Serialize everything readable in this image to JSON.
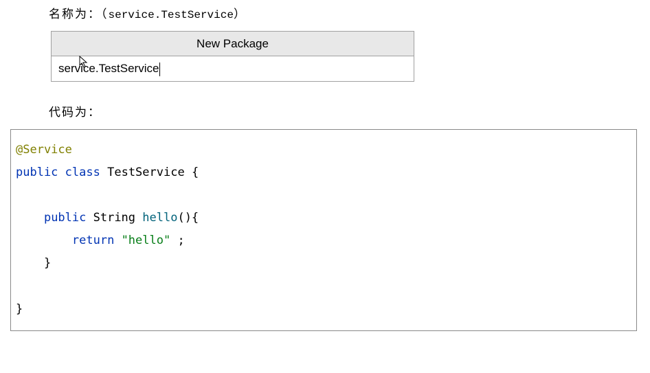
{
  "headings": {
    "name_prefix": "名称为：（",
    "name_value": "service.TestService",
    "name_suffix": "）",
    "code_label": "代码为："
  },
  "dialog": {
    "title": "New Package",
    "input_value": "service.TestService"
  },
  "code": {
    "annotation": "@Service",
    "kw_public1": "public",
    "kw_class": "class",
    "classname": "TestService",
    "brace_open": " {",
    "blank": "",
    "indent1": "    ",
    "kw_public2": "public",
    "rettype": " String ",
    "method": "hello",
    "parens_brace": "(){",
    "indent2": "        ",
    "kw_return": "return",
    "space": " ",
    "string_lit": "\"hello\"",
    "semi": " ;",
    "close_method": "    }",
    "close_class": "}"
  }
}
